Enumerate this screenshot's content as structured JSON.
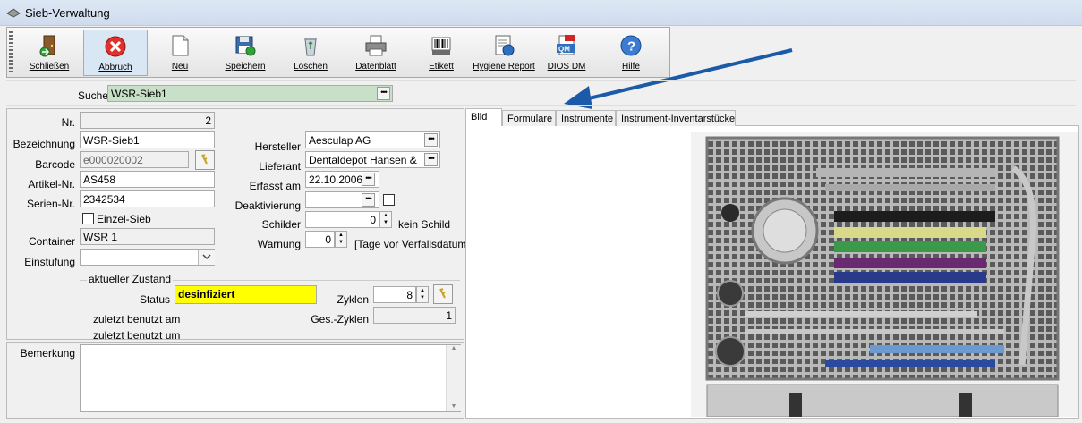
{
  "window": {
    "title": "Sieb-Verwaltung"
  },
  "toolbar": {
    "buttons": [
      {
        "label": "Schließen"
      },
      {
        "label": "Abbruch"
      },
      {
        "label": "Neu"
      },
      {
        "label": "Speichern"
      },
      {
        "label": "Löschen"
      },
      {
        "label": "Datenblatt"
      },
      {
        "label": "Etikett"
      },
      {
        "label": "Hygiene Report"
      },
      {
        "label": "DIOS DM"
      },
      {
        "label": "Hilfe"
      }
    ],
    "icons": [
      "exit-door-icon",
      "cancel-icon",
      "new-document-icon",
      "save-icon",
      "recycle-bin-icon",
      "printer-icon",
      "barcode-label-icon",
      "hygiene-report-icon",
      "pdf-qm-icon",
      "help-icon"
    ]
  },
  "search": {
    "label": "Suche",
    "value": "WSR-Sieb1"
  },
  "form": {
    "nr_label": "Nr.",
    "nr_value": "2",
    "bezeichnung_label": "Bezeichnung",
    "bezeichnung_value": "WSR-Sieb1",
    "barcode_label": "Barcode",
    "barcode_value": "e000020002",
    "artikel_label": "Artikel-Nr.",
    "artikel_value": "AS458",
    "serien_label": "Serien-Nr.",
    "serien_value": "2342534",
    "einzel_label": "Einzel-Sieb",
    "container_label": "Container",
    "container_value": "WSR 1",
    "einstufung_label": "Einstufung",
    "einstufung_value": "",
    "hersteller_label": "Hersteller",
    "hersteller_value": "Aesculap AG",
    "lieferant_label": "Lieferant",
    "lieferant_value": "Dentaldepot Hansen &",
    "erfasst_label": "Erfasst am",
    "erfasst_value": "22.10.2006",
    "deaktivierung_label": "Deaktivierung",
    "deaktivierung_value": "",
    "schilder_label": "Schilder",
    "schilder_value": "0",
    "schilder_suffix": "kein Schild",
    "warnung_label": "Warnung",
    "warnung_value": "0",
    "warnung_suffix": "[Tage vor Verfallsdatum]"
  },
  "zustand": {
    "group_label": "aktueller Zustand",
    "status_label": "Status",
    "status_value": "desinfiziert",
    "zyklen_label": "Zyklen",
    "zyklen_value": "8",
    "ges_zyklen_label": "Ges.-Zyklen",
    "ges_zyklen_value": "1",
    "benutzt_am_label": "zuletzt benutzt am",
    "benutzt_um_label": "zuletzt benutzt um"
  },
  "bemerkung": {
    "label": "Bemerkung",
    "value": ""
  },
  "tabs": [
    {
      "label": "Bild"
    },
    {
      "label": "Formulare"
    },
    {
      "label": "Instrumente"
    },
    {
      "label": "Instrument-Inventarstücke"
    }
  ],
  "colors": {
    "accent_arrow": "#1a5aa8",
    "status_yellow": "#ffff00",
    "search_green": "#c8e0c8"
  }
}
